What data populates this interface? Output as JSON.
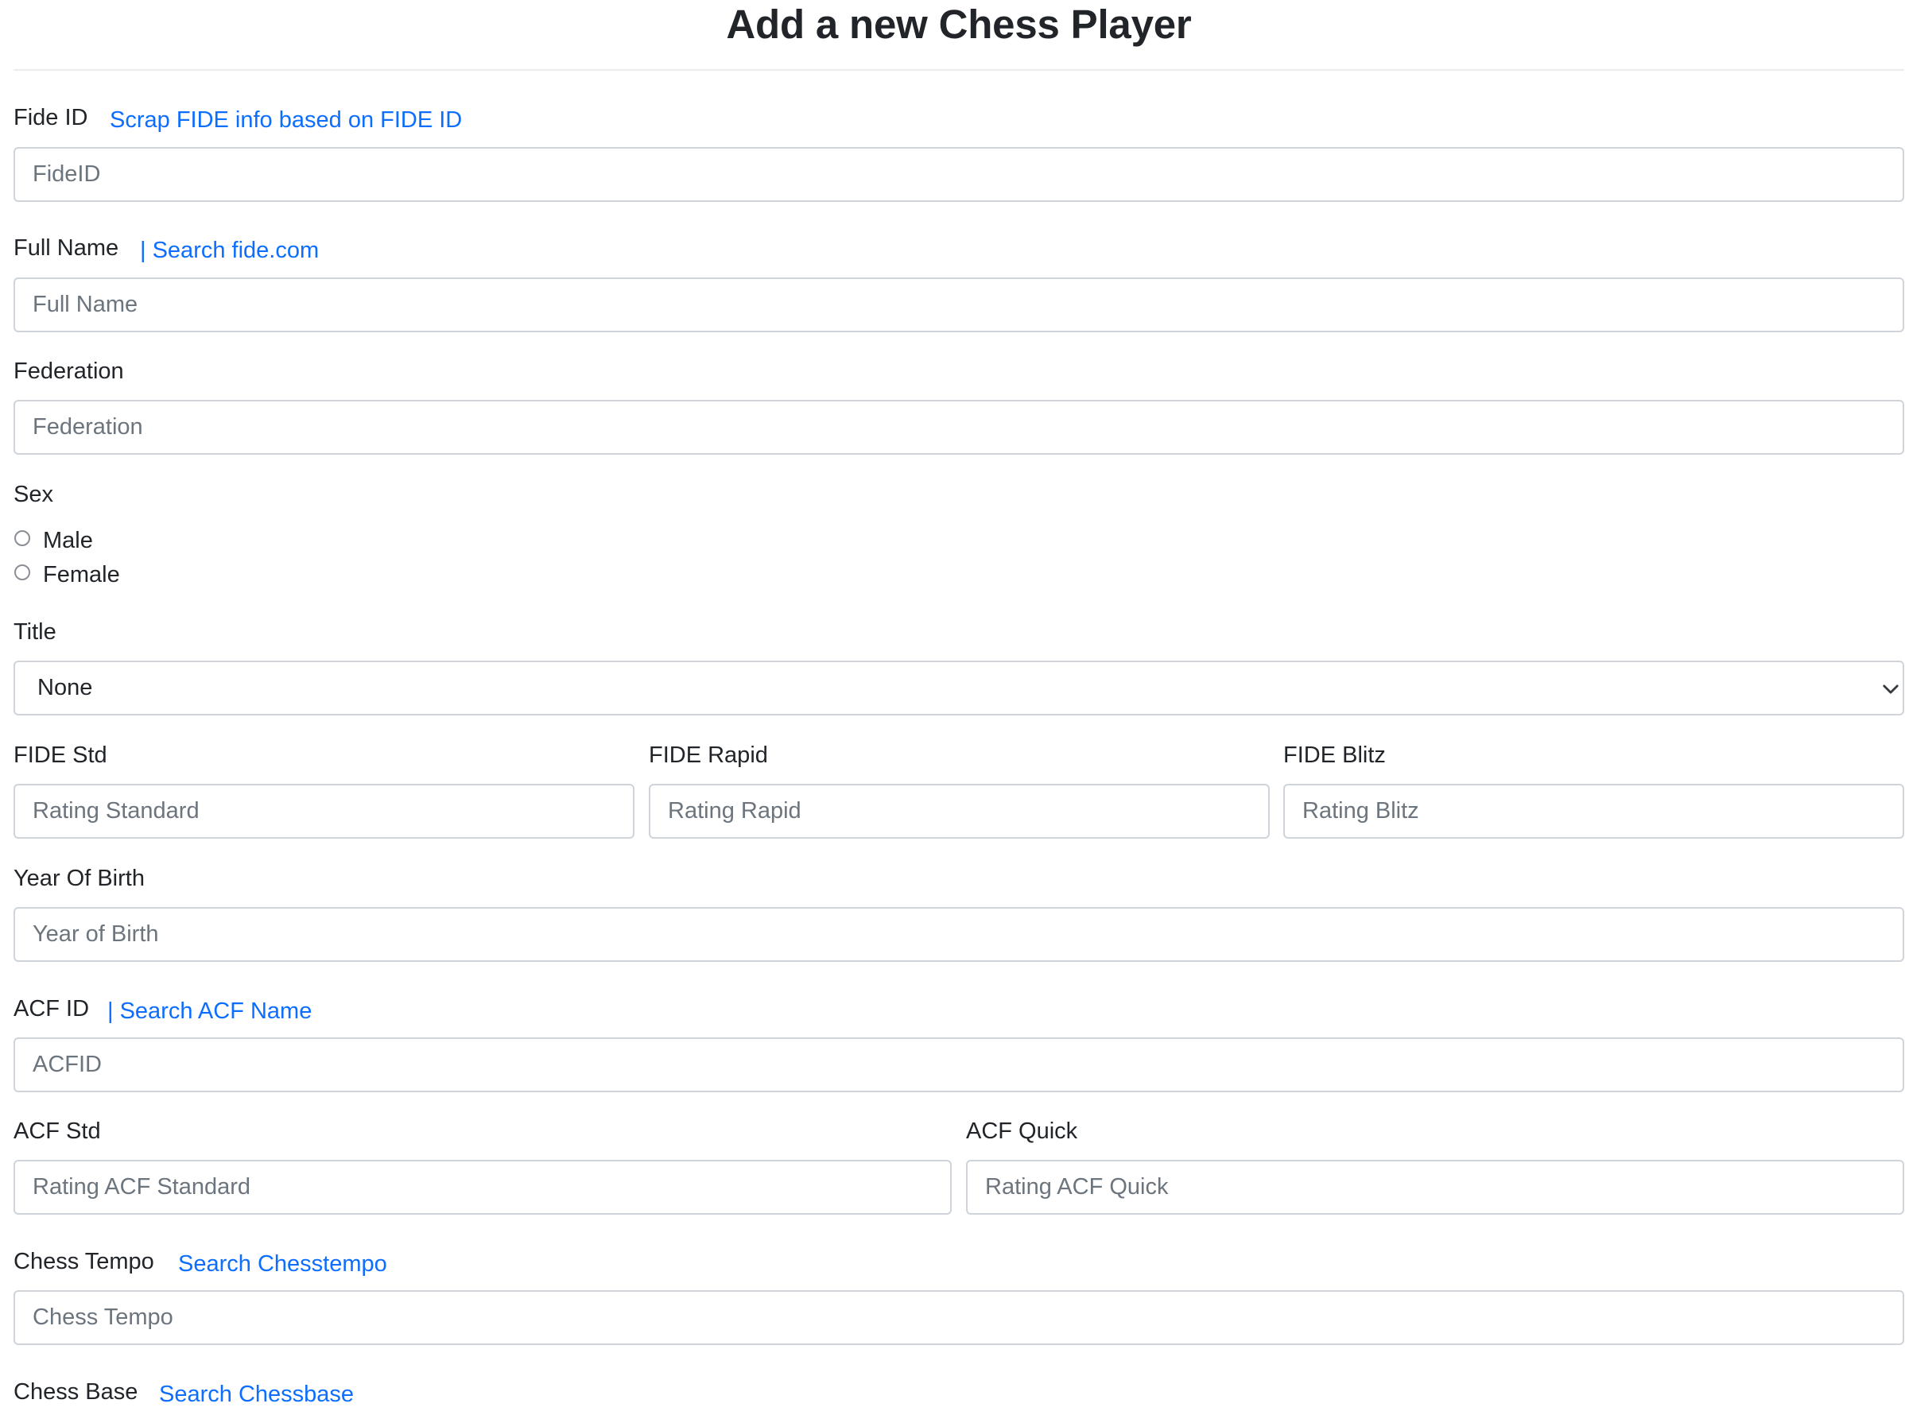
{
  "page": {
    "title": "Add a new Chess Player"
  },
  "form": {
    "fide_id": {
      "label": "Fide ID",
      "link": "Scrap FIDE info based on FIDE ID",
      "placeholder": "FideID"
    },
    "full_name": {
      "label": "Full Name",
      "link": "| Search fide.com",
      "placeholder": "Full Name"
    },
    "federation": {
      "label": "Federation",
      "placeholder": "Federation"
    },
    "sex": {
      "label": "Sex",
      "options": [
        "Male",
        "Female"
      ]
    },
    "title": {
      "label": "Title",
      "selected": "None"
    },
    "fide_std": {
      "label": "FIDE Std",
      "placeholder": "Rating Standard"
    },
    "fide_rapid": {
      "label": "FIDE Rapid",
      "placeholder": "Rating Rapid"
    },
    "fide_blitz": {
      "label": "FIDE Blitz",
      "placeholder": "Rating Blitz"
    },
    "year_of_birth": {
      "label": "Year Of Birth",
      "placeholder": "Year of Birth"
    },
    "acf_id": {
      "label": "ACF ID",
      "link": "| Search ACF Name",
      "placeholder": "ACFID"
    },
    "acf_std": {
      "label": "ACF Std",
      "placeholder": "Rating ACF Standard"
    },
    "acf_quick": {
      "label": "ACF Quick",
      "placeholder": "Rating ACF Quick"
    },
    "chess_tempo": {
      "label": "Chess Tempo",
      "link": "Search Chesstempo",
      "placeholder": "Chess Tempo"
    },
    "chess_base": {
      "label": "Chess Base",
      "link": "Search Chessbase"
    }
  },
  "colors": {
    "link": "#0d6efd",
    "text": "#212529",
    "placeholder": "#6c757d",
    "border": "#ced4da"
  }
}
